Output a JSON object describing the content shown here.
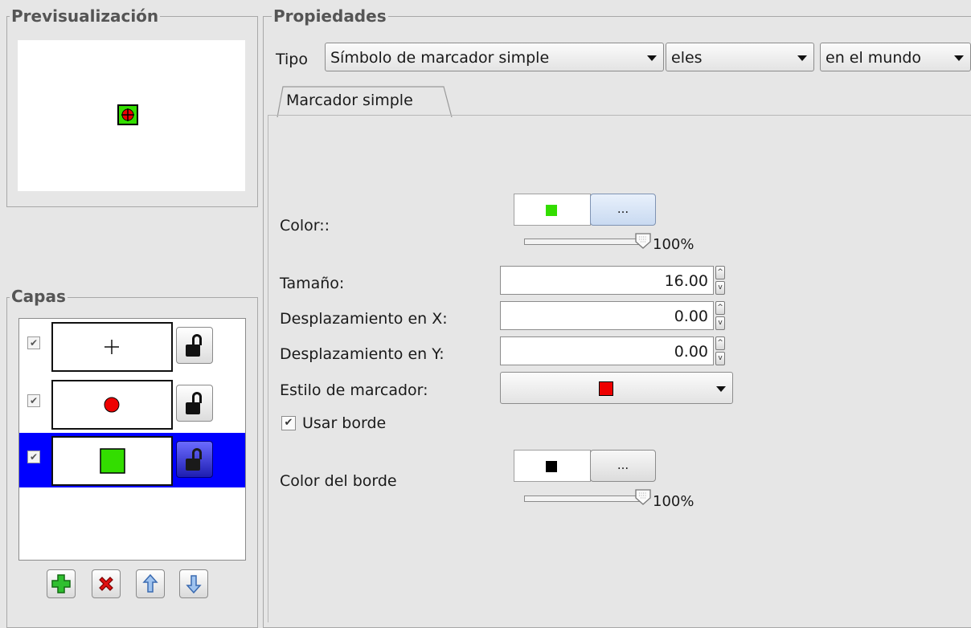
{
  "preview_group": {
    "title": "Previsualización"
  },
  "layers_group": {
    "title": "Capas",
    "layers": [
      {
        "checked": true,
        "symbol": "cross",
        "locked": false,
        "selected": false
      },
      {
        "checked": true,
        "symbol": "red-circle",
        "locked": false,
        "selected": false
      },
      {
        "checked": true,
        "symbol": "green-square",
        "locked": false,
        "selected": true
      }
    ],
    "buttons": [
      "add-layer",
      "remove-layer",
      "move-up",
      "move-down"
    ]
  },
  "properties": {
    "title": "Propiedades",
    "type_label": "Tipo",
    "type_value": "Símbolo de marcador simple",
    "units_value": "eles",
    "units_scope": "en el mundo",
    "tab_label": "Marcador simple",
    "color_label": "Color::",
    "color_value": "#33dd00",
    "color_button": "...",
    "color_opacity": "100%",
    "size_label": "Tamaño:",
    "size_value": "16.00",
    "offset_x_label": "Desplazamiento en X:",
    "offset_x_value": "0.00",
    "offset_y_label": "Desplazamiento en Y:",
    "offset_y_value": "0.00",
    "marker_style_label": "Estilo de marcador:",
    "marker_style_color": "#ee0000",
    "use_border_label": "Usar borde",
    "use_border_checked": true,
    "border_color_label": "Color del borde",
    "border_color_value": "#000000",
    "border_color_button": "...",
    "border_opacity": "100%"
  },
  "colors": {
    "selection": "#0000ff",
    "green": "#33dd00",
    "red": "#ee0000"
  }
}
